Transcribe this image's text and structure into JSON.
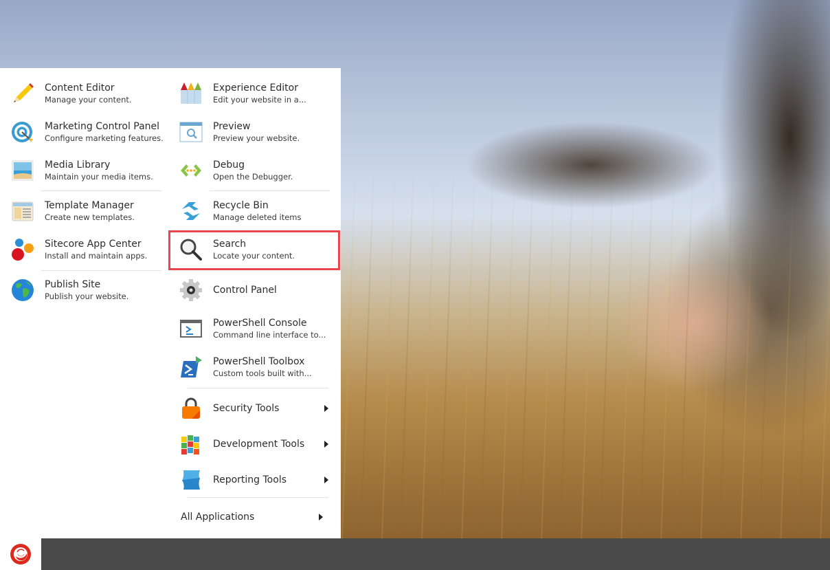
{
  "start_menu": {
    "left_column": [
      {
        "title": "Content Editor",
        "desc": "Manage your content.",
        "icon": "pencil-icon"
      },
      {
        "title": "Marketing Control Panel",
        "desc": "Configure marketing features.",
        "icon": "target-icon"
      },
      {
        "title": "Media Library",
        "desc": "Maintain your media items.",
        "icon": "media-library-icon"
      },
      {
        "title": "Template Manager",
        "desc": "Create new templates.",
        "icon": "template-icon"
      },
      {
        "title": "Sitecore App Center",
        "desc": "Install and maintain apps.",
        "icon": "app-center-icon"
      },
      {
        "title": "Publish Site",
        "desc": "Publish your website.",
        "icon": "globe-icon"
      }
    ],
    "right_column": [
      {
        "title": "Experience Editor",
        "desc": "Edit your website in a...",
        "icon": "crayons-icon"
      },
      {
        "title": "Preview",
        "desc": "Preview your website.",
        "icon": "preview-icon"
      },
      {
        "title": "Debug",
        "desc": "Open the Debugger.",
        "icon": "debug-icon"
      },
      {
        "title": "Recycle Bin",
        "desc": "Manage deleted items",
        "icon": "recycle-icon"
      },
      {
        "title": "Search",
        "desc": "Locate your content.",
        "icon": "search-icon",
        "highlighted": true
      },
      {
        "title": "Control Panel",
        "desc": "",
        "icon": "gear-icon"
      },
      {
        "title": "PowerShell Console",
        "desc": "Command line interface to...",
        "icon": "powershell-console-icon"
      },
      {
        "title": "PowerShell Toolbox",
        "desc": "Custom tools built with...",
        "icon": "powershell-toolbox-icon"
      }
    ],
    "submenus": [
      {
        "title": "Security Tools",
        "icon": "lock-icon"
      },
      {
        "title": "Development Tools",
        "icon": "cube-icon"
      },
      {
        "title": "Reporting Tools",
        "icon": "reporting-icon"
      }
    ],
    "all_applications": "All Applications"
  },
  "taskbar": {
    "start_logo": "sitecore-logo-icon"
  },
  "colors": {
    "highlight": "#e8474d",
    "taskbar": "#4a4a4a",
    "logo": "#dc291e"
  }
}
